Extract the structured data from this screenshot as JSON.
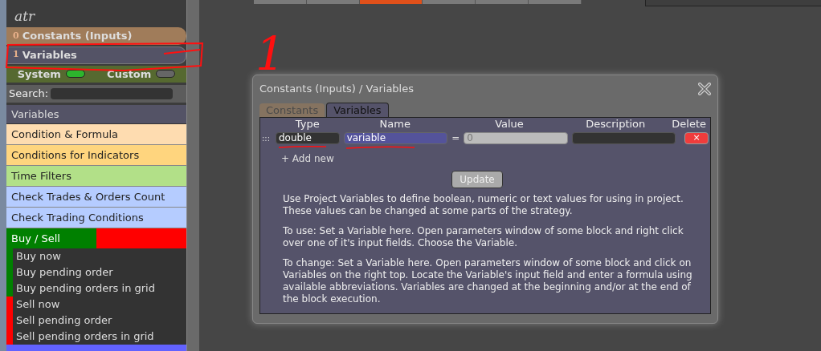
{
  "top_tabs": [
    {
      "selected": false
    },
    {
      "selected": false
    },
    {
      "selected": true
    },
    {
      "selected": false
    },
    {
      "selected": false
    },
    {
      "selected": false
    }
  ],
  "sidebar": {
    "title": "atr",
    "sections": [
      {
        "index": "0",
        "label": "Constants (Inputs)",
        "selected": false
      },
      {
        "index": "1",
        "label": "Variables",
        "selected": true
      }
    ],
    "toggles": [
      {
        "label": "System",
        "on": true
      },
      {
        "label": "Custom",
        "on": false
      }
    ],
    "search": {
      "label": "Search:"
    },
    "header": "Variables",
    "categories": [
      {
        "label": "Condition & Formula",
        "color": "#fedcb0"
      },
      {
        "label": "Conditions for Indicators",
        "color": "#ffd57e"
      },
      {
        "label": "Time Filters",
        "color": "#b2e088"
      },
      {
        "label": "Check Trades & Orders Count",
        "color": "#b5ccff"
      },
      {
        "label": "Check Trading Conditions",
        "color": "#b5ccff"
      }
    ],
    "group": {
      "label": "Buy / Sell",
      "color": "#008000",
      "segments": [
        {
          "color": "#ff0000"
        }
      ],
      "items": [
        {
          "label": "Buy now",
          "color": "#008000"
        },
        {
          "label": "Buy pending order",
          "color": "#008000"
        },
        {
          "label": "Buy pending orders in grid",
          "color": "#008000"
        },
        {
          "label": "Sell now",
          "color": "#ff0000"
        },
        {
          "label": "Sell pending order",
          "color": "#ff0000"
        },
        {
          "label": "Sell pending orders in grid",
          "color": "#ff0000"
        }
      ]
    }
  },
  "annotation": {
    "label": "1"
  },
  "dialog": {
    "title": "Constants (Inputs) / Variables",
    "tabs": [
      {
        "label": "Constants",
        "selected": false
      },
      {
        "label": "Variables",
        "selected": true
      }
    ],
    "columns": [
      "Type",
      "Name",
      "Value",
      "Description",
      "Delete"
    ],
    "rows": [
      {
        "handle": ":::",
        "type": "double",
        "name": "variable",
        "equals": "=",
        "value": "0",
        "delete": "×"
      }
    ],
    "add_link": "+ Add new",
    "button": "Update",
    "help": [
      "Use Project Variables to define boolean, numeric or text values for using in project. These values can be changed at some parts of the strategy.",
      "To use: Set a Variable here. Open parameters window of some block and right click over one of it's input fields. Choose the Variable.",
      "To change: Set a Variable here. Open parameters window of some block and click on Variables on the right top. Locate the Variable's input field and enter a formula using available abbreviations. Variables are changed at the beginning and/or at the end of the block execution."
    ]
  }
}
